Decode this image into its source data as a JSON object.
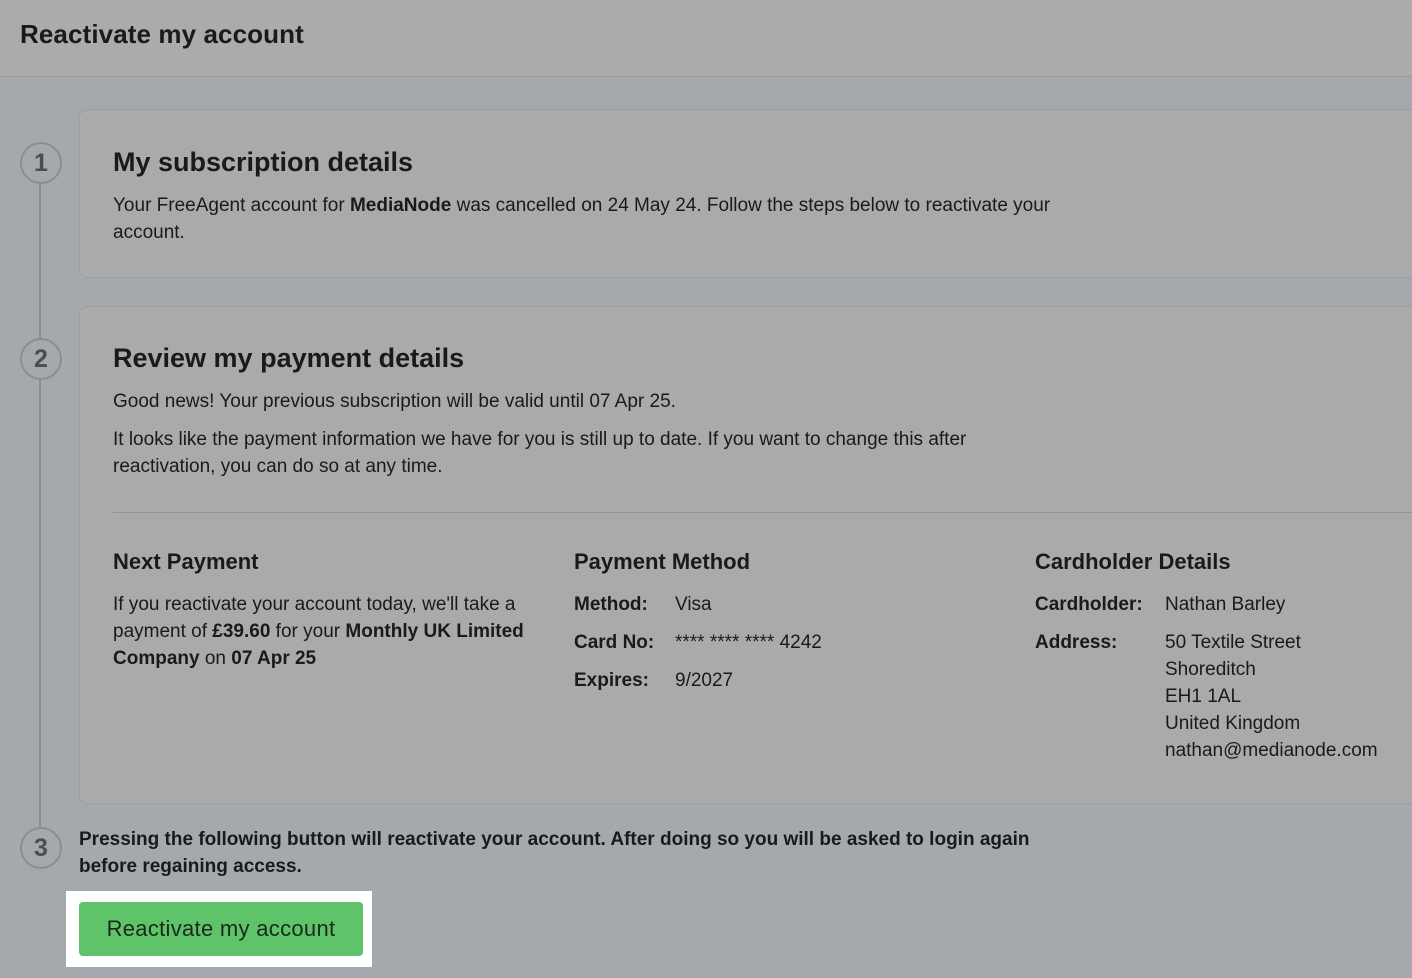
{
  "header": {
    "title": "Reactivate my account"
  },
  "steps": {
    "one": {
      "number": "1",
      "title": "My subscription details",
      "text_before": "Your FreeAgent account for ",
      "company": "MediaNode",
      "text_after": " was cancelled on 24 May 24. Follow the steps below to reactivate your account."
    },
    "two": {
      "number": "2",
      "title": "Review my payment details",
      "good_news": "Good news! Your previous subscription will be valid until 07 Apr 25.",
      "info": "It looks like the payment information we have for you is still up to date. If you want to change this after reactivation, you can do so at any time.",
      "next_payment": {
        "heading": "Next Payment",
        "t1": "If you reactivate your account today, we'll take a payment of ",
        "amount": "£39.60",
        "t2": " for your ",
        "plan": "Monthly UK Limited Company",
        "t3": " on ",
        "date": "07 Apr 25"
      },
      "payment_method": {
        "heading": "Payment Method",
        "method_label": "Method:",
        "method_value": "Visa",
        "card_label": "Card No:",
        "card_value": "**** **** **** 4242",
        "expires_label": "Expires:",
        "expires_value": "9/2027"
      },
      "cardholder": {
        "heading": "Cardholder Details",
        "name_label": "Cardholder:",
        "name_value": "Nathan Barley",
        "address_label": "Address:",
        "address_lines": [
          "50 Textile Street",
          "Shoreditch",
          "EH1 1AL",
          "United Kingdom",
          "nathan@medianode.com"
        ]
      }
    },
    "three": {
      "number": "3",
      "text": "Pressing the following button will reactivate your account. After doing so you will be asked to login again before regaining access.",
      "button_label": "Reactivate my account"
    }
  }
}
